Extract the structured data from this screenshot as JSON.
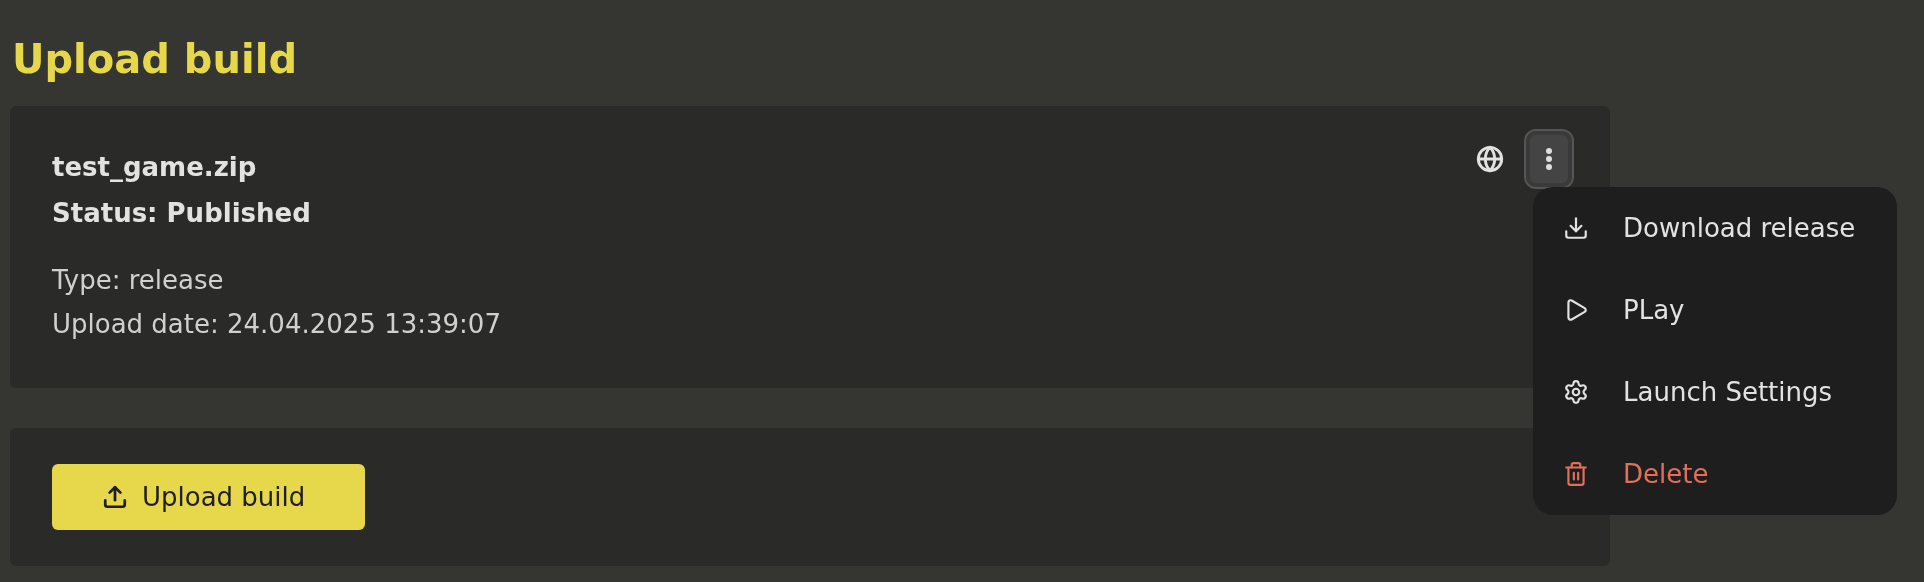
{
  "title": "Upload build",
  "builds": [
    {
      "file_name": "test_game.zip",
      "status": "Status: Published",
      "type": "Type: release",
      "upload_date": "Upload date: 24.04.2025 13:39:07",
      "menu_open": true
    }
  ],
  "menu": [
    {
      "kind": "download",
      "label": "Download release",
      "danger": false
    },
    {
      "kind": "play",
      "label": "PLay",
      "danger": false
    },
    {
      "kind": "settings",
      "label": "Launch Settings",
      "danger": false
    },
    {
      "kind": "delete",
      "label": "Delete",
      "danger": true
    }
  ],
  "upload_button": "Upload build"
}
